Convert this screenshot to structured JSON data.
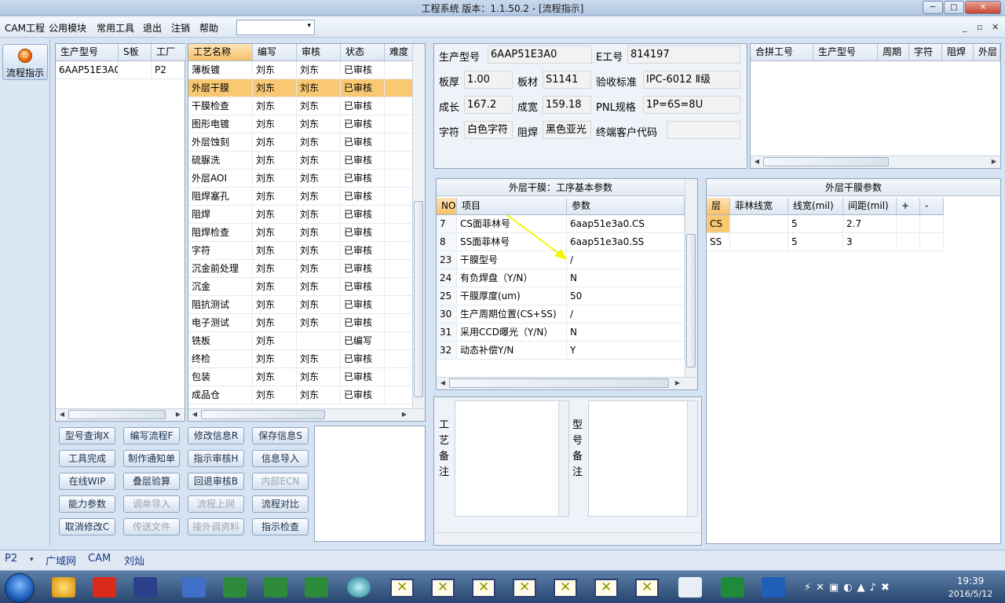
{
  "window": {
    "title": "工程系统  版本：1.1.50.2 - [流程指示]",
    "btn_min": "─",
    "btn_max": "□",
    "btn_close": "✕"
  },
  "menu": {
    "items": [
      "CAM工程",
      "公用模块",
      "常用工具",
      "退出",
      "注销",
      "帮助"
    ],
    "combo_arrow": "▾",
    "mdi_buttons": [
      "_",
      "▫",
      "✕"
    ]
  },
  "nav": {
    "button_label": "流程指示"
  },
  "model_grid": {
    "headers": [
      "生产型号",
      "S板",
      "工厂"
    ],
    "rows": [
      [
        "6AAP51E3A0",
        "",
        "P2"
      ]
    ]
  },
  "process_grid": {
    "headers": [
      "工艺名称",
      "编写",
      "审核",
      "状态",
      "难度"
    ],
    "rows": [
      [
        "薄板镀",
        "刘东",
        "刘东",
        "已审核",
        ""
      ],
      [
        "外层干膜",
        "刘东",
        "刘东",
        "已审核",
        ""
      ],
      [
        "干膜检查",
        "刘东",
        "刘东",
        "已审核",
        ""
      ],
      [
        "图形电镀",
        "刘东",
        "刘东",
        "已审核",
        ""
      ],
      [
        "外层蚀刻",
        "刘东",
        "刘东",
        "已审核",
        ""
      ],
      [
        "硫脲洗",
        "刘东",
        "刘东",
        "已审核",
        ""
      ],
      [
        "外层AOI",
        "刘东",
        "刘东",
        "已审核",
        ""
      ],
      [
        "阻焊塞孔",
        "刘东",
        "刘东",
        "已审核",
        ""
      ],
      [
        "阻焊",
        "刘东",
        "刘东",
        "已审核",
        ""
      ],
      [
        "阻焊检查",
        "刘东",
        "刘东",
        "已审核",
        ""
      ],
      [
        "字符",
        "刘东",
        "刘东",
        "已审核",
        ""
      ],
      [
        "沉金前处理",
        "刘东",
        "刘东",
        "已审核",
        ""
      ],
      [
        "沉金",
        "刘东",
        "刘东",
        "已审核",
        ""
      ],
      [
        "阻抗测试",
        "刘东",
        "刘东",
        "已审核",
        ""
      ],
      [
        "电子测试",
        "刘东",
        "刘东",
        "已审核",
        ""
      ],
      [
        "铣板",
        "刘东",
        "",
        "已编写",
        ""
      ],
      [
        "终检",
        "刘东",
        "刘东",
        "已审核",
        ""
      ],
      [
        "包装",
        "刘东",
        "刘东",
        "已审核",
        ""
      ],
      [
        "成品仓",
        "刘东",
        "刘东",
        "已审核",
        ""
      ]
    ]
  },
  "buttons": [
    {
      "label": "型号查询X",
      "disabled": false
    },
    {
      "label": "编写流程F",
      "disabled": false
    },
    {
      "label": "修改信息R",
      "disabled": false
    },
    {
      "label": "保存信息S",
      "disabled": false
    },
    {
      "label": "工具完成",
      "disabled": false
    },
    {
      "label": "制作通知单",
      "disabled": false
    },
    {
      "label": "指示审核H",
      "disabled": false
    },
    {
      "label": "信息导入",
      "disabled": false
    },
    {
      "label": "在线WIP",
      "disabled": false
    },
    {
      "label": "叠层验算",
      "disabled": false
    },
    {
      "label": "回退审核B",
      "disabled": false
    },
    {
      "label": "内部ECN",
      "disabled": true
    },
    {
      "label": "能力参数",
      "disabled": false
    },
    {
      "label": "调单导入",
      "disabled": true
    },
    {
      "label": "流程上网",
      "disabled": true
    },
    {
      "label": "流程对比",
      "disabled": false
    },
    {
      "label": "取消修改C",
      "disabled": false
    },
    {
      "label": "传送文件",
      "disabled": true
    },
    {
      "label": "接外调资料",
      "disabled": true
    },
    {
      "label": "指示检查",
      "disabled": false
    }
  ],
  "info": {
    "model_label": "生产型号",
    "model_value": "6AAP51E3A0",
    "eno_label": "E工号",
    "eno_value": "814197",
    "thickness_label": "板厚",
    "thickness_value": "1.00",
    "material_label": "板材",
    "material_value": "S1141",
    "standard_label": "验收标准",
    "standard_value": "IPC-6012 Ⅱ级",
    "length_label": "成长",
    "length_value": "167.2",
    "width_label": "成宽",
    "width_value": "159.18",
    "pnl_label": "PNL规格",
    "pnl_value": "1P=6S=8U",
    "char_label": "字符",
    "char_value": "白色字符",
    "mask_label": "阻焊",
    "mask_value": "黑色亚光",
    "client_label": "终端客户代码",
    "client_value": ""
  },
  "merge_grid": {
    "headers": [
      "合拼工号",
      "生产型号",
      "周期",
      "字符",
      "阻焊",
      "外层"
    ]
  },
  "param_grid": {
    "title": "外层干膜：工序基本参数",
    "headers": [
      "NO",
      "项目",
      "参数"
    ],
    "rows": [
      [
        "7",
        "CS面菲林号",
        "6aap51e3a0.CS"
      ],
      [
        "8",
        "SS面菲林号",
        "6aap51e3a0.SS"
      ],
      [
        "23",
        "干膜型号",
        "/"
      ],
      [
        "24",
        "有负焊盘（Y/N）",
        "N"
      ],
      [
        "25",
        "干膜厚度(um)",
        "50"
      ],
      [
        "30",
        "生产周期位置(CS+SS)",
        "/"
      ],
      [
        "31",
        "采用CCD曝光（Y/N）",
        "N"
      ],
      [
        "32",
        "动态补偿Y/N",
        "Y"
      ]
    ]
  },
  "film_grid": {
    "title": "外层干膜参数",
    "headers": [
      "层",
      "菲林线宽",
      "线宽(mil)",
      "间距(mil)",
      "+",
      "-"
    ],
    "rows": [
      [
        "CS",
        "",
        "5",
        "2.7",
        "",
        ""
      ],
      [
        "SS",
        "",
        "5",
        "3",
        "",
        ""
      ]
    ]
  },
  "remarks": {
    "process_label": "工艺备注",
    "model_label": "型号备注"
  },
  "status": {
    "factory": "P2",
    "items": [
      "广域网",
      "CAM",
      "刘灿"
    ]
  },
  "taskbar": {
    "clock_time": "19:39",
    "clock_date": "2016/5/12"
  },
  "colors": {
    "selection": "#f8c873",
    "accent": "#e8670c"
  }
}
